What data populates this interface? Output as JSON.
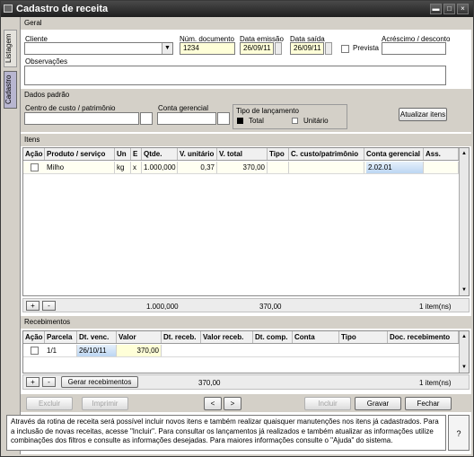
{
  "window": {
    "title": "Cadastro de receita",
    "min": "▬",
    "max": "□",
    "close": "×"
  },
  "tabs": {
    "listagem": "Listagem",
    "cadastro": "Cadastro"
  },
  "geral": {
    "section": "Geral",
    "cliente_label": "Cliente",
    "cliente_value": "",
    "num_doc_label": "Núm. documento",
    "num_doc_value": "1234",
    "data_emissao_label": "Data emissão",
    "data_emissao_value": "26/09/11",
    "data_saida_label": "Data saída",
    "data_saida_value": "26/09/11",
    "prevista_label": "Prevista",
    "acrescimo_label": "Acréscimo / desconto",
    "acrescimo_value": "",
    "observacoes_label": "Observações",
    "observacoes_value": ""
  },
  "dados_padrao": {
    "section": "Dados padrão",
    "centro_label": "Centro de custo / patrimônio",
    "conta_label": "Conta gerencial",
    "tipo_label": "Tipo de lançamento",
    "total_label": "Total",
    "unitario_label": "Unitário",
    "atualizar_btn": "Atualizar itens"
  },
  "itens": {
    "section": "Itens",
    "columns": [
      "Ação",
      "Produto / serviço",
      "Un",
      "E",
      "Qtde.",
      "V. unitário",
      "V. total",
      "Tipo",
      "C. custo/patrimônio",
      "Conta gerencial",
      "Ass."
    ],
    "rows": [
      {
        "produto": "Milho",
        "un": "kg",
        "e": "x",
        "qtde": "1.000,000",
        "vunit": "0,37",
        "vtotal": "370,00",
        "tipo": "",
        "ccusto": "",
        "conta": "2.02.01",
        "ass": ""
      }
    ],
    "add": "+",
    "remove": "-",
    "total_qtde": "1.000,000",
    "total_valor": "370,00",
    "count": "1 item(ns)"
  },
  "recebimentos": {
    "section": "Recebimentos",
    "columns": [
      "Ação",
      "Parcela",
      "Dt. venc.",
      "Valor",
      "Dt. receb.",
      "Valor receb.",
      "Dt. comp.",
      "Conta",
      "Tipo",
      "Doc. recebimento"
    ],
    "rows": [
      {
        "parcela": "1/1",
        "dtvenc": "26/10/11",
        "valor": "370,00"
      }
    ],
    "add": "+",
    "remove": "-",
    "gerar_btn": "Gerar recebimentos",
    "total_valor": "370,00",
    "count": "1 item(ns)"
  },
  "toolbar": {
    "excluir": "Excluir",
    "imprimir": "Imprimir",
    "prev": "<",
    "next": ">",
    "incluir": "Incluir",
    "gravar": "Gravar",
    "fechar": "Fechar"
  },
  "help": {
    "text": "Através da rotina de receita será possível incluir novos itens e também realizar quaisquer manutenções nos itens já cadastrados. Para a inclusão de novas receitas, acesse \"Incluir\". Para consultar os lançamentos já realizados e também atualizar as informações utilize combinações dos filtros e consulte as informações desejadas. Para maiores informações consulte o \"Ajuda\" do sistema.",
    "q": "?"
  }
}
